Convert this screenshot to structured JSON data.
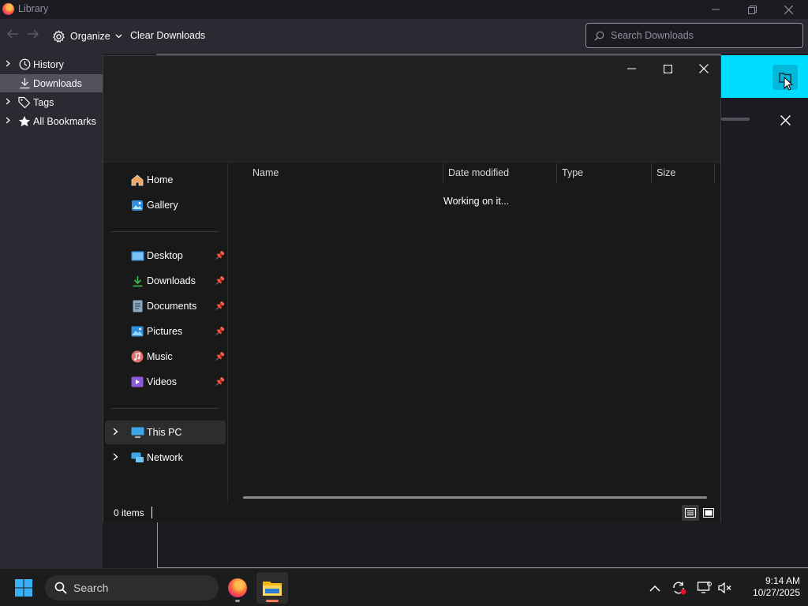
{
  "library": {
    "title": "Library",
    "toolbar": {
      "organize_label": "Organize",
      "clear_label": "Clear Downloads",
      "search_placeholder": "Search Downloads"
    },
    "sidebar": [
      {
        "label": "History",
        "icon": "clock-icon",
        "expandable": true
      },
      {
        "label": "Downloads",
        "icon": "download-icon",
        "expandable": false,
        "selected": true
      },
      {
        "label": "Tags",
        "icon": "tag-icon",
        "expandable": true
      },
      {
        "label": "All Bookmarks",
        "icon": "star-icon",
        "expandable": true
      }
    ],
    "accent_color": "#00ddff"
  },
  "explorer": {
    "nav": {
      "top": [
        {
          "label": "Home",
          "icon": "home-icon"
        },
        {
          "label": "Gallery",
          "icon": "gallery-icon"
        }
      ],
      "quick_access": [
        {
          "label": "Desktop",
          "icon": "desktop-icon",
          "pinned": true
        },
        {
          "label": "Downloads",
          "icon": "download-icon",
          "pinned": true
        },
        {
          "label": "Documents",
          "icon": "document-icon",
          "pinned": true
        },
        {
          "label": "Pictures",
          "icon": "pictures-icon",
          "pinned": true
        },
        {
          "label": "Music",
          "icon": "music-icon",
          "pinned": true
        },
        {
          "label": "Videos",
          "icon": "videos-icon",
          "pinned": true
        }
      ],
      "locations": [
        {
          "label": "This PC",
          "icon": "computer-icon",
          "selected": true
        },
        {
          "label": "Network",
          "icon": "network-icon"
        }
      ]
    },
    "columns": [
      "Name",
      "Date modified",
      "Type",
      "Size"
    ],
    "status_message": "Working on it...",
    "item_count": "0 items"
  },
  "taskbar": {
    "search_label": "Search",
    "apps": [
      {
        "name": "Firefox",
        "icon": "firefox-icon"
      },
      {
        "name": "File Explorer",
        "icon": "folder-icon",
        "active": true
      }
    ],
    "time": "9:14 AM",
    "date": "10/27/2025"
  }
}
